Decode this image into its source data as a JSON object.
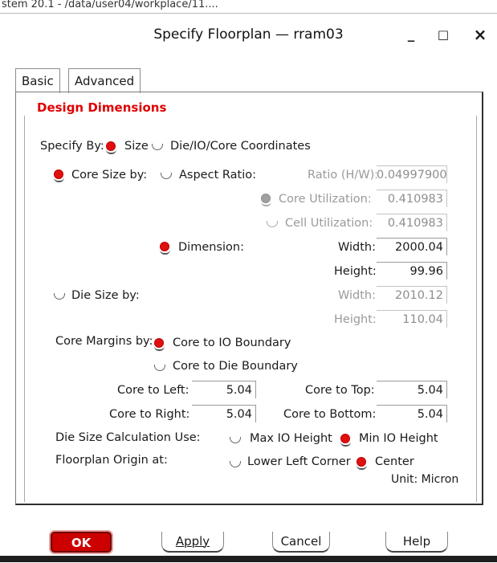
{
  "background_title": "stem 20.1 - /data/user04/workplace/11....",
  "window": {
    "title": "Specify Floorplan — rram03",
    "minimize": "_",
    "maximize": "□",
    "close": "×"
  },
  "tabs": [
    {
      "label": "Basic",
      "active": true
    },
    {
      "label": "Advanced",
      "active": false
    }
  ],
  "group_title": "Design Dimensions",
  "specify_by": {
    "label": "Specify By:",
    "options": [
      {
        "label": "Size",
        "selected": true
      },
      {
        "label": "Die/IO/Core Coordinates",
        "selected": false
      }
    ]
  },
  "core_size": {
    "label": "Core Size by:",
    "aspect_ratio_label": "Aspect Ratio:",
    "ratio_label": "Ratio (H/W):",
    "ratio_value": "0.04997900",
    "core_util_label": "Core Utilization:",
    "core_util_value": "0.410983",
    "cell_util_label": "Cell Utilization:",
    "cell_util_value": "0.410983",
    "dimension_label": "Dimension:",
    "width_label": "Width:",
    "width_value": "2000.04",
    "height_label": "Height:",
    "height_value": "99.96"
  },
  "die_size": {
    "label": "Die Size by:",
    "width_label": "Width:",
    "width_value": "2010.12",
    "height_label": "Height:",
    "height_value": "110.04"
  },
  "core_margins": {
    "label": "Core Margins by:",
    "opt_io": "Core to IO Boundary",
    "opt_die": "Core to Die Boundary",
    "left_label": "Core to Left:",
    "left_value": "5.04",
    "top_label": "Core to Top:",
    "top_value": "5.04",
    "right_label": "Core to Right:",
    "right_value": "5.04",
    "bottom_label": "Core to Bottom:",
    "bottom_value": "5.04"
  },
  "die_calc": {
    "label": "Die Size Calculation Use:",
    "opt_max": "Max IO Height",
    "opt_min": "Min IO Height"
  },
  "origin": {
    "label": "Floorplan Origin at:",
    "opt_lower_left": "Lower Left Corner",
    "opt_center": "Center"
  },
  "unit": "Unit: Micron",
  "buttons": {
    "ok": "OK",
    "apply": "Apply",
    "cancel": "Cancel",
    "help": "Help"
  },
  "colors": {
    "accent_red": "#e00000",
    "ok_button": "#cc0000"
  }
}
